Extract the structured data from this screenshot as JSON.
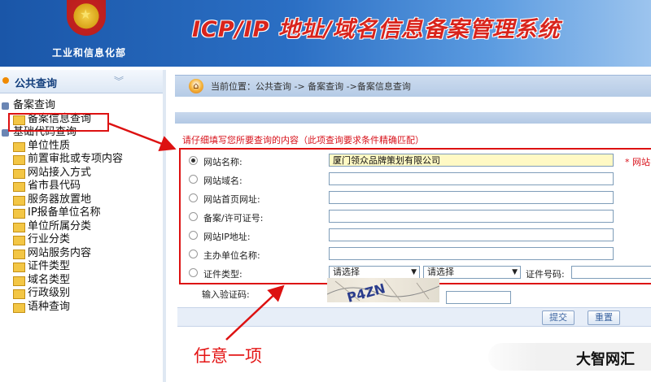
{
  "header": {
    "ministry": "工业和信息化部",
    "system_title": "ICP/IP 地址/域名信息备案管理系统"
  },
  "sidebar": {
    "title": "公共查询",
    "tree": [
      {
        "label": "备案查询",
        "level": 0
      },
      {
        "label": "备案信息查询",
        "level": 1,
        "selected": true
      },
      {
        "label": "基础代码查询",
        "level": 0
      },
      {
        "label": "单位性质",
        "level": 1
      },
      {
        "label": "前置审批或专项内容",
        "level": 1
      },
      {
        "label": "网站接入方式",
        "level": 1
      },
      {
        "label": "省市县代码",
        "level": 1
      },
      {
        "label": "服务器放置地",
        "level": 1
      },
      {
        "label": "IP报备单位名称",
        "level": 1
      },
      {
        "label": "单位所属分类",
        "level": 1
      },
      {
        "label": "行业分类",
        "level": 1
      },
      {
        "label": "网站服务内容",
        "level": 1
      },
      {
        "label": "证件类型",
        "level": 1
      },
      {
        "label": "域名类型",
        "level": 1
      },
      {
        "label": "行政级别",
        "level": 1
      },
      {
        "label": "语种查询",
        "level": 1
      }
    ]
  },
  "breadcrumb": {
    "text": "当前位置：公共查询  -> 备案查询 ->备案信息查询"
  },
  "form": {
    "notice": "请仔细填写您所要查询的内容（此项查询要求条件精确匹配）",
    "rows": [
      {
        "label": "网站名称:",
        "value": "厦门领众品牌策划有限公司",
        "checked": true,
        "required_note": "* 网站名"
      },
      {
        "label": "网站域名:",
        "value": ""
      },
      {
        "label": "网站首页网址:",
        "value": ""
      },
      {
        "label": "备案/许可证号:",
        "value": ""
      },
      {
        "label": "网站IP地址:",
        "value": ""
      },
      {
        "label": "主办单位名称:",
        "value": ""
      }
    ],
    "cert": {
      "label": "证件类型:",
      "select1": "请选择",
      "select2": "请选择",
      "number_label": "证件号码:"
    },
    "captcha": {
      "label": "输入验证码:",
      "text": "P4ZN"
    },
    "buttons": {
      "submit": "提交",
      "reset": "重置"
    }
  },
  "annotation": "任意一项",
  "watermark": "大智网汇",
  "colors": {
    "header_blue": "#2b6fc4",
    "highlight_red": "#dd1111",
    "title_red": "#d9241c"
  }
}
